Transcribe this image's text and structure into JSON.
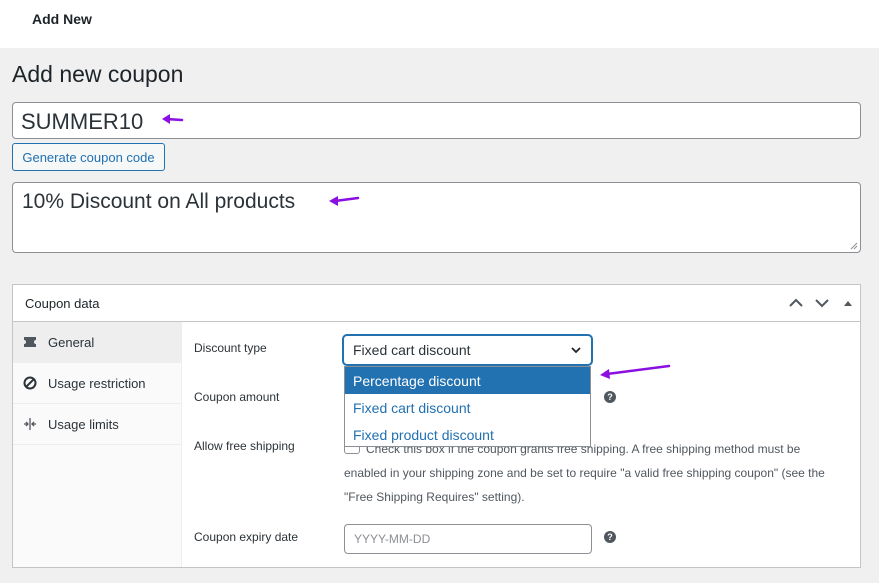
{
  "topbar": {
    "breadcrumb": "Add New"
  },
  "page": {
    "title": "Add new coupon"
  },
  "coupon_code": {
    "value": "SUMMER10"
  },
  "generate_button": {
    "label": "Generate coupon code"
  },
  "description": {
    "value": "10% Discount on All products"
  },
  "coupon_data": {
    "title": "Coupon data",
    "tabs": [
      {
        "label": "General",
        "icon": "ticket-icon",
        "active": true
      },
      {
        "label": "Usage restriction",
        "icon": "ban-icon",
        "active": false
      },
      {
        "label": "Usage limits",
        "icon": "limits-icon",
        "active": false
      }
    ],
    "fields": {
      "discount_type_label": "Discount type",
      "discount_type_value": "Fixed cart discount",
      "discount_type_options": [
        "Percentage discount",
        "Fixed cart discount",
        "Fixed product discount"
      ],
      "highlighted_option": "Percentage discount",
      "coupon_amount_label": "Coupon amount",
      "free_shipping_label": "Allow free shipping",
      "free_shipping_text": "Check this box if the coupon grants free shipping. A free shipping method must be enabled in your shipping zone and be set to require \"a valid free shipping coupon\" (see the \"Free Shipping Requires\" setting).",
      "expiry_label": "Coupon expiry date",
      "expiry_placeholder": "YYYY-MM-DD"
    }
  },
  "colors": {
    "accent": "#2271b1",
    "annotation_arrow": "#8a0fe0",
    "background": "#f0f0f1"
  }
}
